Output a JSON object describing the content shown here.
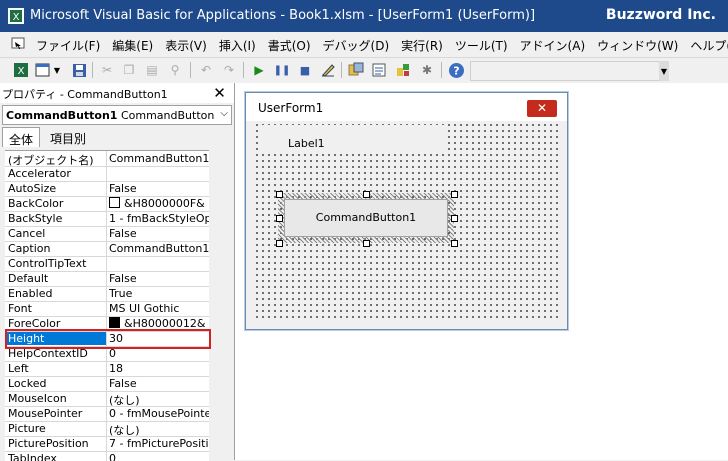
{
  "window": {
    "title": "Microsoft Visual Basic for Applications - Book1.xlsm - [UserForm1 (UserForm)]",
    "brand": "Buzzword Inc."
  },
  "menu": [
    "ファイル(F)",
    "編集(E)",
    "表示(V)",
    "挿入(I)",
    "書式(O)",
    "デバッグ(D)",
    "実行(R)",
    "ツール(T)",
    "アドイン(A)",
    "ウィンドウ(W)",
    "ヘルプ(H)"
  ],
  "properties": {
    "title": "プロパティ - CommandButton1",
    "object_name": "CommandButton1",
    "object_type": "CommandButton",
    "tabs": [
      "全体",
      "項目別"
    ],
    "rows": [
      {
        "name": "(オブジェクト名)",
        "value": "CommandButton1"
      },
      {
        "name": "Accelerator",
        "value": ""
      },
      {
        "name": "AutoSize",
        "value": "False"
      },
      {
        "name": "BackColor",
        "value": "&H8000000F&",
        "swatch": "#ffffff"
      },
      {
        "name": "BackStyle",
        "value": "1 - fmBackStyleOp"
      },
      {
        "name": "Cancel",
        "value": "False"
      },
      {
        "name": "Caption",
        "value": "CommandButton1"
      },
      {
        "name": "ControlTipText",
        "value": ""
      },
      {
        "name": "Default",
        "value": "False"
      },
      {
        "name": "Enabled",
        "value": "True"
      },
      {
        "name": "Font",
        "value": "MS UI Gothic"
      },
      {
        "name": "ForeColor",
        "value": "&H80000012&",
        "swatch": "#000000"
      },
      {
        "name": "Height",
        "value": "30",
        "selected": true
      },
      {
        "name": "HelpContextID",
        "value": "0"
      },
      {
        "name": "Left",
        "value": "18"
      },
      {
        "name": "Locked",
        "value": "False"
      },
      {
        "name": "MouseIcon",
        "value": "(なし)"
      },
      {
        "name": "MousePointer",
        "value": "0 - fmMousePointe"
      },
      {
        "name": "Picture",
        "value": "(なし)"
      },
      {
        "name": "PicturePosition",
        "value": "7 - fmPicturePositi"
      },
      {
        "name": "TabIndex",
        "value": "0"
      }
    ]
  },
  "form": {
    "title": "UserForm1",
    "label_caption": "Label1",
    "button_caption": "CommandButton1"
  },
  "colors": {
    "titlebar": "#1e4a8c",
    "selection": "#0078d7",
    "highlight_box": "#d32020"
  }
}
